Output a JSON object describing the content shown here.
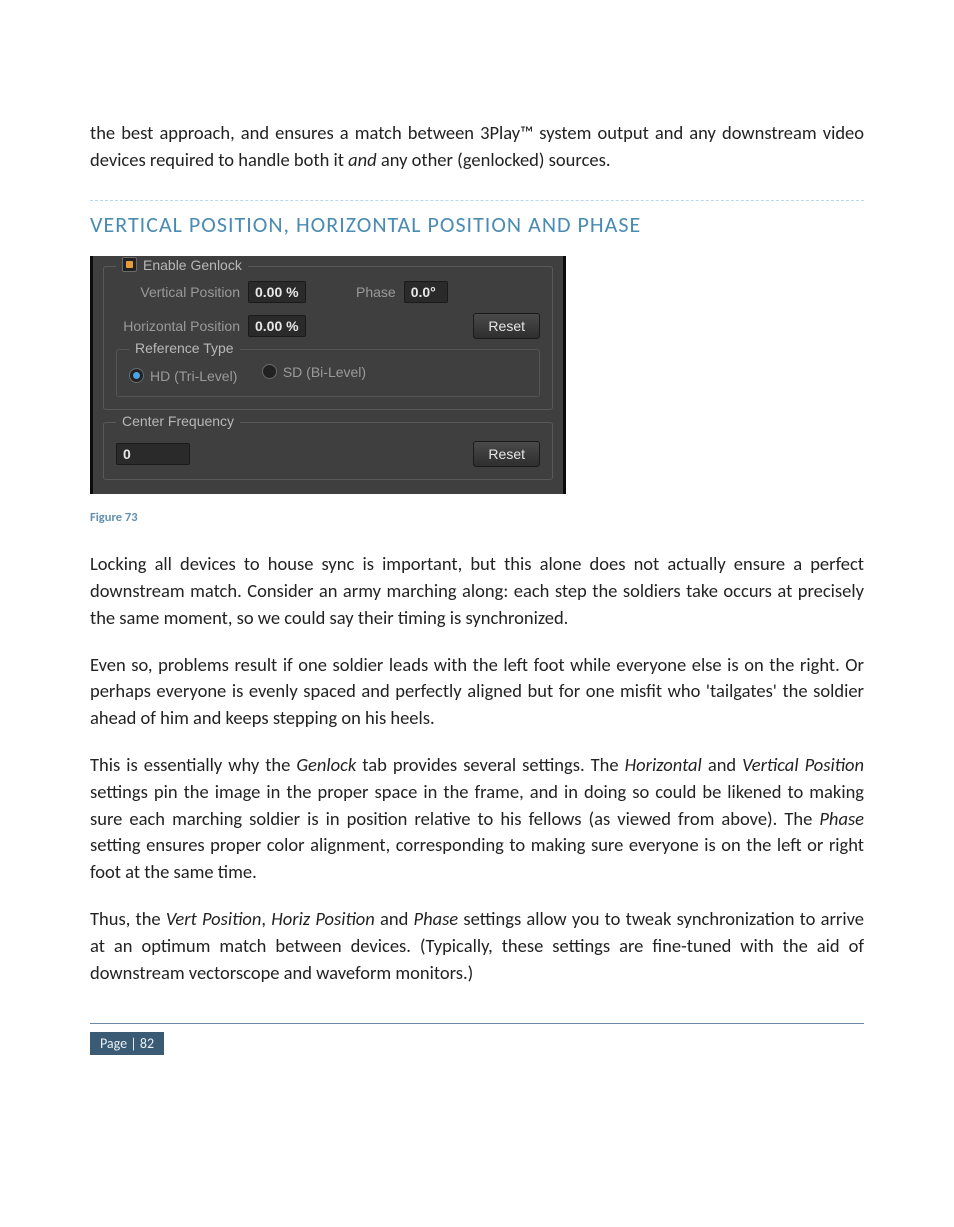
{
  "intro": "the best approach, and ensures a match between 3Play™ system output and any downstream video devices required to handle both it ",
  "intro_em": "and",
  "intro_tail": " any other (genlocked) sources.",
  "heading": "VERTICAL POSITION, HORIZONTAL POSITION AND PHASE",
  "panel": {
    "enable_label": "Enable Genlock",
    "vert_label": "Vertical Position",
    "vert_value": "0.00 %",
    "phase_label": "Phase",
    "phase_value": "0.0°",
    "horiz_label": "Horizontal Position",
    "horiz_value": "0.00 %",
    "reset_btn": "Reset",
    "ref_type_label": "Reference Type",
    "hd_label": "HD (Tri-Level)",
    "sd_label": "SD (Bi-Level)",
    "center_freq_label": "Center Frequency",
    "center_freq_value": "0",
    "reset_btn2": "Reset"
  },
  "figure_caption": "Figure 73",
  "para1": "Locking all devices to house sync is important, but this alone does not actually ensure a perfect downstream match.  Consider an army marching along: each step the soldiers take occurs at precisely the same moment, so we could say their timing is synchronized.",
  "para2": "Even so, problems result if one soldier leads with the left foot while everyone else is on the right. Or perhaps everyone is evenly spaced and perfectly aligned but for one misfit who 'tailgates' the soldier ahead of him and keeps stepping on his heels.",
  "para3_a": "This is essentially why the ",
  "para3_b": "Genlock",
  "para3_c": " tab provides several settings. The ",
  "para3_d": "Horizontal",
  "para3_e": " and ",
  "para3_f": "Vertical Position",
  "para3_g": " settings pin the image in the proper space in the frame, and in doing so could be likened to making sure each marching soldier is in position relative to his fellows (as viewed from above). The ",
  "para3_h": "Phase",
  "para3_i": " setting ensures proper color alignment, corresponding to making sure everyone is on the left or right foot at the same time.",
  "para4_a": "Thus, the ",
  "para4_b": "Vert Position",
  "para4_c": ", ",
  "para4_d": "Horiz Position",
  "para4_e": " and ",
  "para4_f": "Phase",
  "para4_g": " settings allow you to tweak synchronization to arrive at an optimum match between devices.  (Typically, these settings are fine-tuned with the aid of downstream vectorscope and waveform monitors.)",
  "footer": "Page | 82"
}
